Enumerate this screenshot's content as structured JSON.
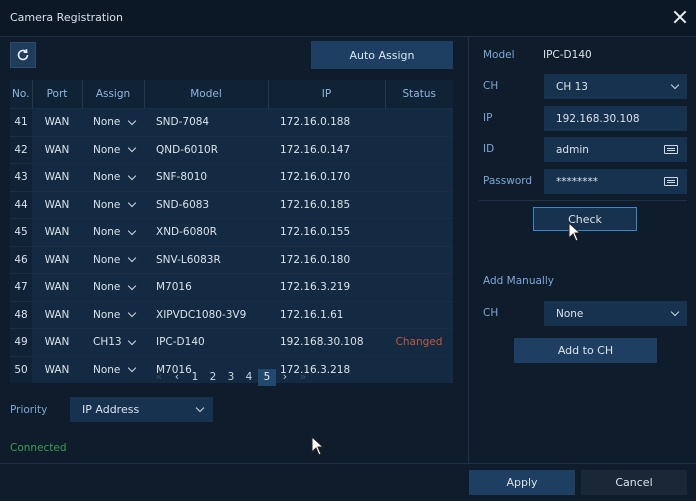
{
  "window": {
    "title": "Camera Registration",
    "close_icon": "close-icon"
  },
  "toolbar": {
    "refresh_icon": "refresh-icon",
    "auto_assign_label": "Auto Assign"
  },
  "table": {
    "headers": [
      "No.",
      "Port",
      "Assign",
      "Model",
      "IP",
      "Status"
    ],
    "rows": [
      {
        "no": "41",
        "port": "WAN",
        "assign": "None",
        "model": "SND-7084",
        "ip": "172.16.0.188",
        "status": ""
      },
      {
        "no": "42",
        "port": "WAN",
        "assign": "None",
        "model": "QND-6010R",
        "ip": "172.16.0.147",
        "status": ""
      },
      {
        "no": "43",
        "port": "WAN",
        "assign": "None",
        "model": "SNF-8010",
        "ip": "172.16.0.170",
        "status": ""
      },
      {
        "no": "44",
        "port": "WAN",
        "assign": "None",
        "model": "SND-6083",
        "ip": "172.16.0.185",
        "status": ""
      },
      {
        "no": "45",
        "port": "WAN",
        "assign": "None",
        "model": "XND-6080R",
        "ip": "172.16.0.155",
        "status": ""
      },
      {
        "no": "46",
        "port": "WAN",
        "assign": "None",
        "model": "SNV-L6083R",
        "ip": "172.16.0.180",
        "status": ""
      },
      {
        "no": "47",
        "port": "WAN",
        "assign": "None",
        "model": "M7016",
        "ip": "172.16.3.219",
        "status": ""
      },
      {
        "no": "48",
        "port": "WAN",
        "assign": "None",
        "model": "XIPVDC1080-3V9",
        "ip": "172.16.1.61",
        "status": ""
      },
      {
        "no": "49",
        "port": "WAN",
        "assign": "CH13",
        "model": "IPC-D140",
        "ip": "192.168.30.108",
        "status": "Changed"
      },
      {
        "no": "50",
        "port": "WAN",
        "assign": "None",
        "model": "M7016",
        "ip": "172.16.3.218",
        "status": ""
      }
    ]
  },
  "pagination": {
    "pages": [
      "1",
      "2",
      "3",
      "4",
      "5"
    ],
    "current": "5",
    "first_icon": "double-chevron-left-icon",
    "prev_icon": "chevron-left-icon",
    "next_icon": "chevron-right-icon",
    "last_icon": "double-chevron-right-icon"
  },
  "priority": {
    "label": "Priority",
    "value": "IP Address"
  },
  "status": {
    "connected": "Connected",
    "color": "#3f9d4f"
  },
  "detail": {
    "model_label": "Model",
    "model_value": "IPC-D140",
    "ch_label": "CH",
    "ch_value": "CH 13",
    "ip_label": "IP",
    "ip_value": "192.168.30.108",
    "id_label": "ID",
    "id_value": "admin",
    "password_label": "Password",
    "password_value": "********",
    "check_label": "Check"
  },
  "manual": {
    "title": "Add Manually",
    "ch_label": "CH",
    "ch_value": "None",
    "add_label": "Add to CH"
  },
  "footer": {
    "apply_label": "Apply",
    "cancel_label": "Cancel"
  },
  "colors": {
    "background": "#0f1c2b",
    "panel": "#16324f",
    "accent": "#1e3f62",
    "changed": "#c0593a"
  }
}
